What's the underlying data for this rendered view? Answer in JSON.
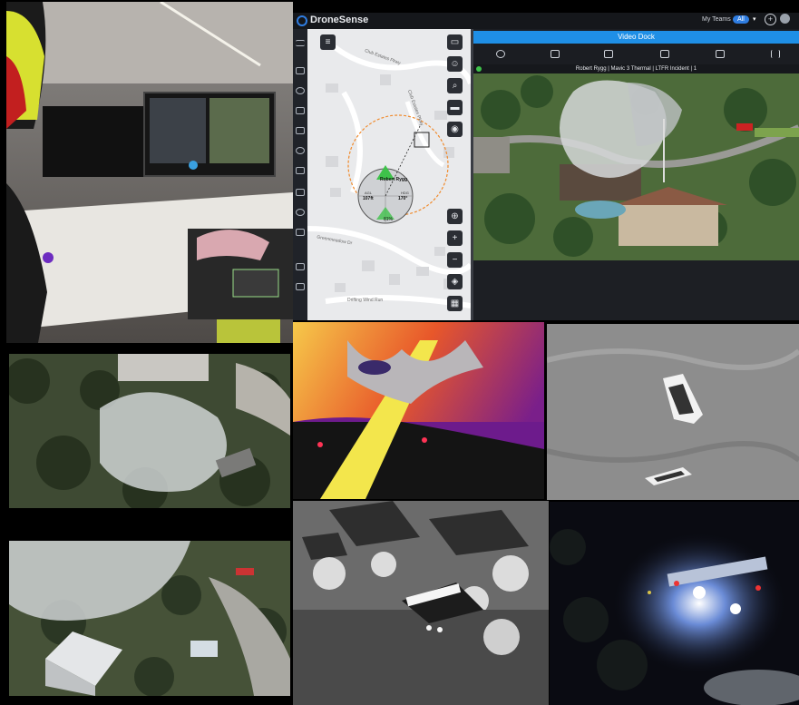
{
  "app": {
    "name": "DroneSense",
    "teams_label": "My Teams",
    "teams_filter": "All",
    "video_dock_label": "Video Dock",
    "feed_title": "Robert Rygg | Mavic 3 Thermal | LTFR Incident | 1"
  },
  "map": {
    "streets": [
      "Club Estates Pkwy",
      "Club Estates Pkwy",
      "Greenmeadow Dr",
      "Drifting Wind Run"
    ],
    "drone_label": "Robert Rygg",
    "readout_left_label": "AGL",
    "readout_left_value": "107ft",
    "readout_right_label": "HDG",
    "readout_right_value": "170°",
    "battery": "81%"
  },
  "colors": {
    "accent": "#2f7de1",
    "dock": "#1f8fe6",
    "live": "#3ec24a",
    "orange_ring": "#f08a2c"
  },
  "icons": {
    "sidebar": [
      "menu-icon",
      "home-icon",
      "sos-icon",
      "map-icon",
      "mail-icon",
      "people-icon",
      "chat-icon",
      "layers-icon",
      "settings-icon",
      "device-icon",
      "doc-icon",
      "folder-icon"
    ],
    "map_right": [
      "clipboard-icon",
      "users-icon",
      "search-icon",
      "ruler-icon",
      "marker-icon",
      "crosshair-icon",
      "zoom-in-icon",
      "zoom-out-icon",
      "layers-icon",
      "grid-icon"
    ],
    "dock_tools": [
      "settings-icon",
      "camera-icon",
      "camera-off-icon",
      "grid-1-icon",
      "grid-2-icon",
      "sort-icon"
    ]
  },
  "photos": {
    "firefighter_desk": "Firefighter at command desk with monitors",
    "smoke_aerial": "Aerial view of smoke over trees",
    "smoke_house": "Aerial view of house near smoke",
    "thermal_color": "Color thermal view of shoreline",
    "thermal_boats": "Thermal view of two boats on water",
    "thermal_neighborhood": "Grayscale thermal view of neighborhood",
    "night_scene": "Night aerial view of emergency vehicles"
  }
}
